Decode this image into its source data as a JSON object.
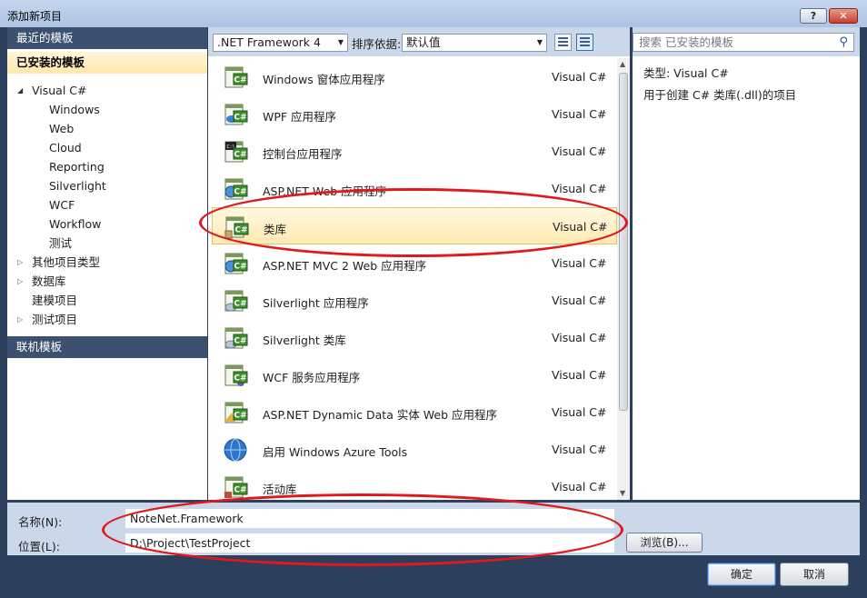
{
  "window": {
    "title": "添加新项目",
    "help_label": "?",
    "close_label": "✕"
  },
  "left_panel": {
    "recent_header": "最近的模板",
    "installed_header": "已安装的模板",
    "online_header": "联机模板",
    "tree": [
      {
        "label": "Visual C#",
        "level": 0,
        "expander": "open"
      },
      {
        "label": "Windows",
        "level": 1
      },
      {
        "label": "Web",
        "level": 1
      },
      {
        "label": "Cloud",
        "level": 1
      },
      {
        "label": "Reporting",
        "level": 1
      },
      {
        "label": "Silverlight",
        "level": 1
      },
      {
        "label": "WCF",
        "level": 1
      },
      {
        "label": "Workflow",
        "level": 1
      },
      {
        "label": "测试",
        "level": 1
      },
      {
        "label": "其他项目类型",
        "level": 0,
        "expander": "closed"
      },
      {
        "label": "数据库",
        "level": 0,
        "expander": "closed"
      },
      {
        "label": "建模项目",
        "level": 0
      },
      {
        "label": "测试项目",
        "level": 0,
        "expander": "closed"
      }
    ]
  },
  "toolbar": {
    "framework": ".NET Framework 4",
    "sort_label": "排序依据:",
    "sort_value": "默认值"
  },
  "search": {
    "placeholder": "搜索 已安装的模板"
  },
  "templates": [
    {
      "name": "Windows 窗体应用程序",
      "lang": "Visual C#",
      "icon": "windows-forms-icon"
    },
    {
      "name": "WPF 应用程序",
      "lang": "Visual C#",
      "icon": "wpf-app-icon"
    },
    {
      "name": "控制台应用程序",
      "lang": "Visual C#",
      "icon": "console-app-icon"
    },
    {
      "name": "ASP.NET Web 应用程序",
      "lang": "Visual C#",
      "icon": "aspnet-web-icon"
    },
    {
      "name": "类库",
      "lang": "Visual C#",
      "icon": "class-library-icon",
      "selected": true
    },
    {
      "name": "ASP.NET MVC 2 Web 应用程序",
      "lang": "Visual C#",
      "icon": "aspnet-mvc-icon"
    },
    {
      "name": "Silverlight 应用程序",
      "lang": "Visual C#",
      "icon": "silverlight-app-icon"
    },
    {
      "name": "Silverlight 类库",
      "lang": "Visual C#",
      "icon": "silverlight-lib-icon"
    },
    {
      "name": "WCF 服务应用程序",
      "lang": "Visual C#",
      "icon": "wcf-service-icon"
    },
    {
      "name": "ASP.NET Dynamic Data 实体 Web 应用程序",
      "lang": "Visual C#",
      "icon": "dynamic-data-icon"
    },
    {
      "name": "启用 Windows Azure Tools",
      "lang": "Visual C#",
      "icon": "azure-globe-icon"
    },
    {
      "name": "活动库",
      "lang": "Visual C#",
      "icon": "activity-library-icon"
    }
  ],
  "details": {
    "type_line": "类型:  Visual C#",
    "description": "用于创建 C# 类库(.dll)的项目"
  },
  "form": {
    "name_label": "名称(N):",
    "name_value": "NoteNet.Framework",
    "location_label": "位置(L):",
    "location_value": "D:\\Project\\TestProject",
    "browse_label": "浏览(B)..."
  },
  "buttons": {
    "ok": "确定",
    "cancel": "取消"
  },
  "colors": {
    "annotation": "#e0191d",
    "selection": "#fee9b0",
    "header_dark": "#3c5070"
  }
}
